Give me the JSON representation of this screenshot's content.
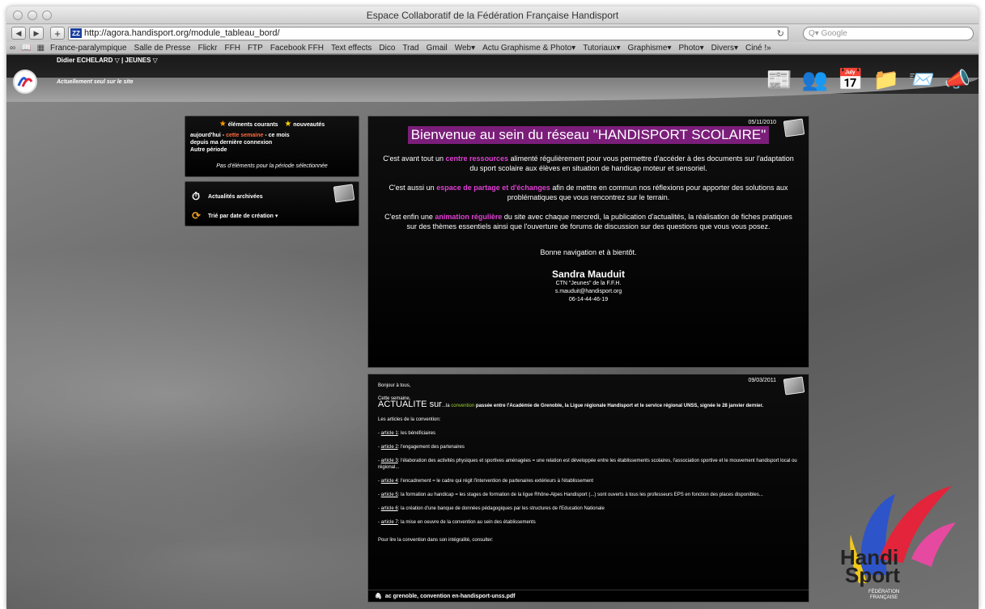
{
  "browser": {
    "window_title": "Espace Collaboratif de la Fédération Française Handisport",
    "url": "http://agora.handisport.org/module_tableau_bord/",
    "search_placeholder": "Q▾ Google",
    "bookmarks": [
      "France-paralympique",
      "Salle de Presse",
      "Flickr",
      "FFH",
      "FTP",
      "Facebook FFH",
      "Text effects",
      "Dico",
      "Trad",
      "Gmail",
      "Web▾",
      "Actu Graphisme & Photo▾",
      "Tutoriaux▾",
      "Graphisme▾",
      "Photo▾",
      "Divers▾",
      "Ciné !»"
    ]
  },
  "site": {
    "user": "Didier ECHELARD ▽ | JEUNES ▽",
    "status": "Actuellement seul sur le site"
  },
  "filters": {
    "legend_current": "éléments courants",
    "legend_new": "nouveautés",
    "today": "aujourd'hui",
    "this_week": "cette semaine",
    "this_month": "ce mois",
    "since_last": "depuis ma dernière connexion",
    "other": "Autre période",
    "empty": "Pas d'éléments pour la période sélectionnée"
  },
  "archives": {
    "archived": "Actualités archivées",
    "sort": "Trié par date de création ▾"
  },
  "article1": {
    "date": "05/11/2010",
    "title": "Bienvenue au sein du réseau \"HANDISPORT SCOLAIRE\"",
    "p1_a": "C'est avant tout un ",
    "p1_hl": "centre ressources",
    "p1_b": " alimenté régulièrement pour vous permettre d'accéder à des documents sur l'adaptation du sport scolaire aux élèves en situation de handicap moteur et sensoriel.",
    "p2_a": "C'est aussi un ",
    "p2_hl": "espace de partage et d'échanges",
    "p2_b": " afin de mettre en commun nos réflexions pour apporter des solutions aux problématiques que vous rencontrez sur le terrain.",
    "p3_a": "C'est enfin une ",
    "p3_hl": "animation régulière",
    "p3_b": " du site avec chaque mercredi, la publication d'actualités, la réalisation de fiches pratiques sur  des thèmes essentiels ainsi que l'ouverture de forums de discussion sur des questions que vous vous posez.",
    "closing": "Bonne navigation et à bientôt.",
    "signer": "Sandra Mauduit",
    "role": "CTN \"Jeunes\" de la F.F.H.",
    "email": "s.mauduit@handisport.org",
    "phone": "06-14-44-46-19"
  },
  "article2": {
    "date": "09/03/2011",
    "greeting": "Bonjour à tous,",
    "week": "Cette semaine,",
    "actu": "ACTUALITE sur",
    "intro_a": "...la ",
    "intro_hl": "convention",
    "intro_b": " passée entre l'Académie de Grenoble, la Ligue régionale Handisport et le service régional UNSS, signée le 28 janvier dernier.",
    "articles_heading": "Les articles de la convention:",
    "items": [
      {
        "ref": "article 1",
        "text": ": les bénéficiaires"
      },
      {
        "ref": "article 2",
        "text": ": l'engagement des partenaires"
      },
      {
        "ref": "article 3",
        "text": ": l'élaboration des activités physiques et sportives aménagées = une relation est développée entre les établissements scolaires, l'association sportive et le mouvement handisport local ou régional..."
      },
      {
        "ref": "article 4",
        "text": ": l'encadrement = le cadre qui régit l'intervention de partenaires extérieurs à l'établissement"
      },
      {
        "ref": "article 5",
        "text": ": la formation au handicap = les stages de formation de la ligue Rhône-Alpes Handisport (...) sont ouverts à tous les professeurs EPS en fonction des places disponibles..."
      },
      {
        "ref": "article 6",
        "text": ": la création d'une banque de données pédagogiques par les structures de l'Education Nationale"
      },
      {
        "ref": "article 7",
        "text": ": la mise en oeuvre de la convention au sein des établissements"
      }
    ],
    "read_more": "Pour lire la convention dans son intégralité, consulter:",
    "attachment": "ac grenoble, convention en-handisport-unss.pdf"
  },
  "brand": {
    "word1": "Handi",
    "word2": "Sport",
    "sub1": "FÉDÉRATION",
    "sub2": "FRANÇAISE"
  }
}
